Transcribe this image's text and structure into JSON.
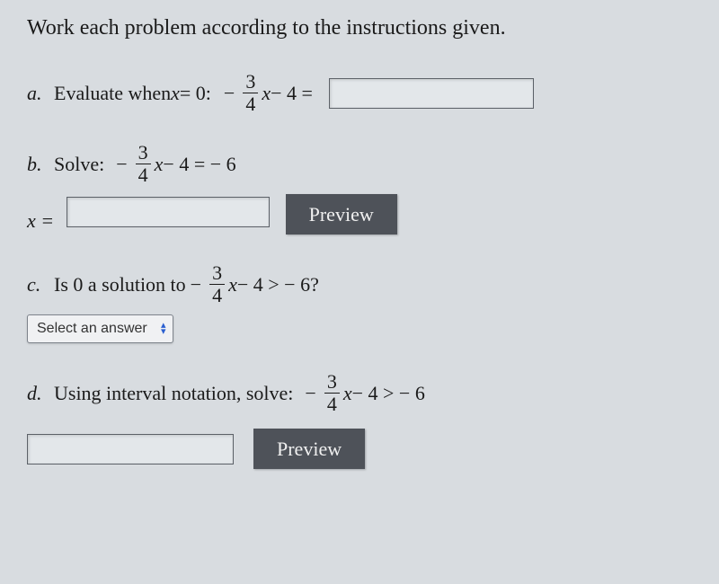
{
  "header": "Work each problem according to the instructions given.",
  "parts": {
    "a": {
      "label": "a.",
      "text_before": "Evaluate when ",
      "var_x": "x",
      "eq_zero": " = 0:",
      "minus": "−",
      "frac_num": "3",
      "frac_den": "4",
      "after_frac": "x",
      "minus2": " − 4 ="
    },
    "b": {
      "label": "b.",
      "text_before": "Solve:",
      "minus": "−",
      "frac_num": "3",
      "frac_den": "4",
      "x": "x",
      "rest": " − 4 =  − 6",
      "x_equals": "x =",
      "preview": "Preview"
    },
    "c": {
      "label": "c.",
      "text_before": "Is 0 a solution to ",
      "minus": "−",
      "frac_num": "3",
      "frac_den": "4",
      "x": "x",
      "rest": " − 4 >  − 6?",
      "select_label": "Select an answer"
    },
    "d": {
      "label": "d.",
      "text_before": "Using interval notation, solve:",
      "minus": "−",
      "frac_num": "3",
      "frac_den": "4",
      "x": "x",
      "rest": " − 4 >  − 6",
      "preview": "Preview"
    }
  }
}
